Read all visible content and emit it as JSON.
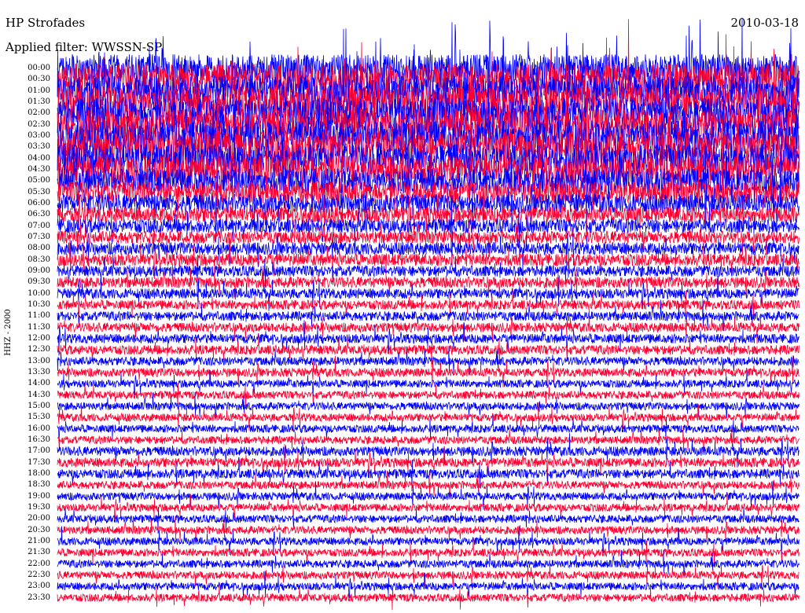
{
  "header": {
    "station": "HP Strofades",
    "date": "2010-03-18",
    "filter_label": "Applied filter:",
    "filter_name": "WWSSN-SP"
  },
  "channel_label": "HHZ - 2000",
  "colors": {
    "trace_even": "#0000ff",
    "trace_odd": "#ff0033",
    "background": "#ffffff",
    "text": "#000000"
  },
  "chart_data": {
    "type": "helicorder",
    "title": "HP Strofades",
    "date": "2010-03-18",
    "filter": "WWSSN-SP",
    "channel": "HHZ - 2000",
    "row_interval_minutes": 30,
    "rows": [
      {
        "start": "00:00",
        "amplitude": 1.8,
        "color": "blue"
      },
      {
        "start": "00:30",
        "amplitude": 2.0,
        "color": "red"
      },
      {
        "start": "01:00",
        "amplitude": 2.0,
        "color": "blue"
      },
      {
        "start": "01:30",
        "amplitude": 2.0,
        "color": "red"
      },
      {
        "start": "02:00",
        "amplitude": 2.0,
        "color": "blue"
      },
      {
        "start": "02:30",
        "amplitude": 2.0,
        "color": "red"
      },
      {
        "start": "03:00",
        "amplitude": 2.0,
        "color": "blue"
      },
      {
        "start": "03:30",
        "amplitude": 2.0,
        "color": "red"
      },
      {
        "start": "04:00",
        "amplitude": 1.9,
        "color": "blue"
      },
      {
        "start": "04:30",
        "amplitude": 1.8,
        "color": "red"
      },
      {
        "start": "05:00",
        "amplitude": 1.6,
        "color": "blue"
      },
      {
        "start": "05:30",
        "amplitude": 1.4,
        "color": "red"
      },
      {
        "start": "06:00",
        "amplitude": 1.2,
        "color": "blue"
      },
      {
        "start": "06:30",
        "amplitude": 1.0,
        "color": "red"
      },
      {
        "start": "07:00",
        "amplitude": 0.9,
        "color": "blue"
      },
      {
        "start": "07:30",
        "amplitude": 0.8,
        "color": "red"
      },
      {
        "start": "08:00",
        "amplitude": 0.8,
        "color": "blue"
      },
      {
        "start": "08:30",
        "amplitude": 0.8,
        "color": "red"
      },
      {
        "start": "09:00",
        "amplitude": 0.7,
        "color": "blue"
      },
      {
        "start": "09:30",
        "amplitude": 0.7,
        "color": "red"
      },
      {
        "start": "10:00",
        "amplitude": 0.65,
        "color": "blue"
      },
      {
        "start": "10:30",
        "amplitude": 0.6,
        "color": "red"
      },
      {
        "start": "11:00",
        "amplitude": 0.6,
        "color": "blue"
      },
      {
        "start": "11:30",
        "amplitude": 0.6,
        "color": "red"
      },
      {
        "start": "12:00",
        "amplitude": 0.6,
        "color": "blue"
      },
      {
        "start": "12:30",
        "amplitude": 0.6,
        "color": "red"
      },
      {
        "start": "13:00",
        "amplitude": 0.55,
        "color": "blue"
      },
      {
        "start": "13:30",
        "amplitude": 0.55,
        "color": "red"
      },
      {
        "start": "14:00",
        "amplitude": 0.5,
        "color": "blue"
      },
      {
        "start": "14:30",
        "amplitude": 0.5,
        "color": "red"
      },
      {
        "start": "15:00",
        "amplitude": 0.5,
        "color": "blue"
      },
      {
        "start": "15:30",
        "amplitude": 0.5,
        "color": "red"
      },
      {
        "start": "16:00",
        "amplitude": 0.5,
        "color": "blue"
      },
      {
        "start": "16:30",
        "amplitude": 0.5,
        "color": "red"
      },
      {
        "start": "17:00",
        "amplitude": 0.6,
        "color": "blue"
      },
      {
        "start": "17:30",
        "amplitude": 0.6,
        "color": "red"
      },
      {
        "start": "18:00",
        "amplitude": 0.6,
        "color": "blue"
      },
      {
        "start": "18:30",
        "amplitude": 0.5,
        "color": "red"
      },
      {
        "start": "19:00",
        "amplitude": 0.5,
        "color": "blue"
      },
      {
        "start": "19:30",
        "amplitude": 0.5,
        "color": "red"
      },
      {
        "start": "20:00",
        "amplitude": 0.5,
        "color": "blue"
      },
      {
        "start": "20:30",
        "amplitude": 0.5,
        "color": "red"
      },
      {
        "start": "21:00",
        "amplitude": 0.5,
        "color": "blue"
      },
      {
        "start": "21:30",
        "amplitude": 0.5,
        "color": "red"
      },
      {
        "start": "22:00",
        "amplitude": 0.5,
        "color": "blue"
      },
      {
        "start": "22:30",
        "amplitude": 0.5,
        "color": "red"
      },
      {
        "start": "23:00",
        "amplitude": 0.5,
        "color": "blue"
      },
      {
        "start": "23:30",
        "amplitude": 0.5,
        "color": "red"
      }
    ]
  }
}
